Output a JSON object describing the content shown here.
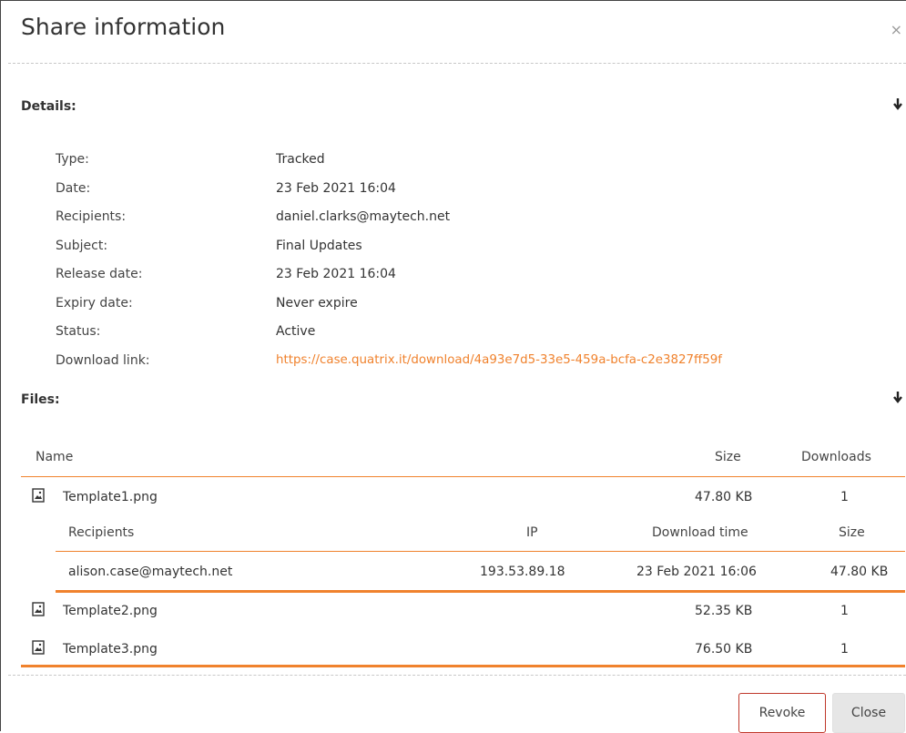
{
  "dialog": {
    "title": "Share information",
    "close_glyph": "×"
  },
  "details": {
    "label": "Details:",
    "rows": [
      {
        "key": "Type:",
        "value": "Tracked"
      },
      {
        "key": "Date:",
        "value": "23 Feb 2021 16:04"
      },
      {
        "key": "Recipients:",
        "value": "daniel.clarks@maytech.net"
      },
      {
        "key": "Subject:",
        "value": "Final Updates"
      },
      {
        "key": "Release date:",
        "value": "23 Feb 2021 16:04"
      },
      {
        "key": "Expiry date:",
        "value": "Never expire"
      },
      {
        "key": "Status:",
        "value": "Active"
      },
      {
        "key": "Download link:",
        "value": "https://case.quatrix.it/download/4a93e7d5-33e5-459a-bcfa-c2e3827ff59f"
      }
    ]
  },
  "files": {
    "label": "Files:",
    "columns": {
      "name": "Name",
      "size": "Size",
      "downloads": "Downloads"
    },
    "items": [
      {
        "name": "Template1.png",
        "size": "47.80 KB",
        "downloads": "1"
      },
      {
        "name": "Template2.png",
        "size": "52.35 KB",
        "downloads": "1"
      },
      {
        "name": "Template3.png",
        "size": "76.50 KB",
        "downloads": "1"
      }
    ],
    "sub_columns": {
      "recipients": "Recipients",
      "ip": "IP",
      "download_time": "Download time",
      "size": "Size"
    },
    "sub_rows": [
      {
        "recipient": "alison.case@maytech.net",
        "ip": "193.53.89.18",
        "download_time": "23 Feb 2021 16:06",
        "size": "47.80 KB"
      }
    ]
  },
  "buttons": {
    "revoke": "Revoke",
    "close": "Close"
  },
  "colors": {
    "accent": "#f0822d",
    "revoke_border": "#c0392b"
  },
  "icons": {
    "close": "close-icon",
    "expand": "arrow-down-icon",
    "file": "image-file-icon"
  }
}
